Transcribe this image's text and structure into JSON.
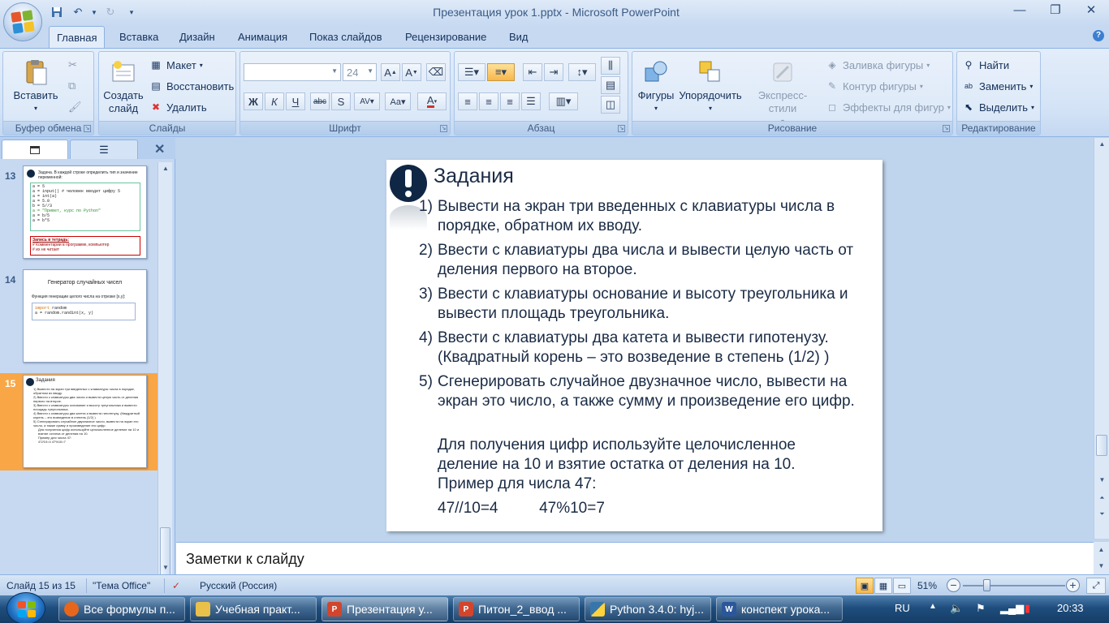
{
  "window": {
    "title": "Презентация урок 1.pptx - Microsoft PowerPoint"
  },
  "tabs": [
    "Главная",
    "Вставка",
    "Дизайн",
    "Анимация",
    "Показ слайдов",
    "Рецензирование",
    "Вид"
  ],
  "ribbon": {
    "clipboard": {
      "label": "Буфер обмена",
      "paste": "Вставить"
    },
    "slides": {
      "label": "Слайды",
      "new_slide": "Создать слайд",
      "layout": "Макет",
      "reset": "Восстановить",
      "delete": "Удалить"
    },
    "font": {
      "label": "Шрифт",
      "font_name": "",
      "font_size": "24"
    },
    "paragraph": {
      "label": "Абзац"
    },
    "drawing": {
      "label": "Рисование",
      "shapes": "Фигуры",
      "arrange": "Упорядочить",
      "quick_styles": "Экспресс-стили",
      "fill": "Заливка фигуры",
      "outline": "Контур фигуры",
      "effects": "Эффекты для фигур"
    },
    "editing": {
      "label": "Редактирование",
      "find": "Найти",
      "replace": "Заменить",
      "select": "Выделить"
    }
  },
  "thumbnails": [
    {
      "number": "13",
      "title": "Задача. В каждой строке определить тип и значение переменной:",
      "code": [
        "a = 5",
        "a = input()   # человек вводит цифру 5",
        "a = int(a)",
        "a = 5.0",
        "b = 5//3",
        "a = \"Привет, курс по Python\"",
        "a = b/5",
        "a = b*5"
      ],
      "note_title": "Запись в тетрадь:",
      "note_lines": [
        "# Комментарии в программе, компьютер",
        "# их не читает"
      ]
    },
    {
      "number": "14",
      "title": "Генератор случайных чисел",
      "subtitle": "Функция генерации целого числа на отрезке [x,y]:",
      "code_kw": "import",
      "code_mod": "random",
      "code_line": "a = random.randint(x, y)"
    },
    {
      "number": "15",
      "title": "Задания",
      "selected": true
    }
  ],
  "slide": {
    "title": "Задания",
    "tasks": [
      {
        "n": "1)",
        "text": "Вывести на экран три введенных с клавиатуры числа в порядке, обратном их вводу."
      },
      {
        "n": "2)",
        "text": "Ввести с клавиатуры два числа и вывести целую часть от деления первого на второе."
      },
      {
        "n": "3)",
        "text": "Ввести с клавиатуры основание и высоту треугольника и вывести площадь треугольника."
      },
      {
        "n": "4)",
        "text": "Ввести с клавиатуры два катета и вывести гипотенузу. (Квадратный корень – это возведение в степень (1/2) )"
      },
      {
        "n": "5)",
        "text": "Сгенерировать случайное двузначное число, вывести на экран это число, а также сумму и произведение его цифр."
      }
    ],
    "hint": "Для получения цифр используйте целочисленное деление на 10 и взятие остатка от деления на 10.",
    "example_label": "Пример для числа 47:",
    "example_div": "47//10=4",
    "example_mod": "47%10=7"
  },
  "notes": {
    "placeholder": "Заметки к слайду"
  },
  "status": {
    "slide": "Слайд 15 из 15",
    "theme": "\"Тема Office\"",
    "language": "Русский (Россия)",
    "zoom": "51%",
    "zoom_fraction": 0.51
  },
  "taskbar": {
    "items": [
      {
        "label": "Все формулы п...",
        "icon_color": "#e8661b",
        "glyph": ""
      },
      {
        "label": "Учебная практ...",
        "icon_color": "#e8c04a",
        "glyph": ""
      },
      {
        "label": "Презентация у...",
        "icon_color": "#d2452c",
        "glyph": "P",
        "active": true
      },
      {
        "label": "Питон_2_ввод ...",
        "icon_color": "#d2452c",
        "glyph": "P"
      },
      {
        "label": "Python 3.4.0: hyj...",
        "icon_color": "#3776ab",
        "glyph": ""
      },
      {
        "label": "конспект урока...",
        "icon_color": "#2b579a",
        "glyph": "W"
      }
    ],
    "lang": "RU",
    "clock": "20:33"
  },
  "colors": {
    "accent": "#f9a646",
    "title_bar": "#c6d9f1",
    "taskbar": "#1e4d7d"
  }
}
